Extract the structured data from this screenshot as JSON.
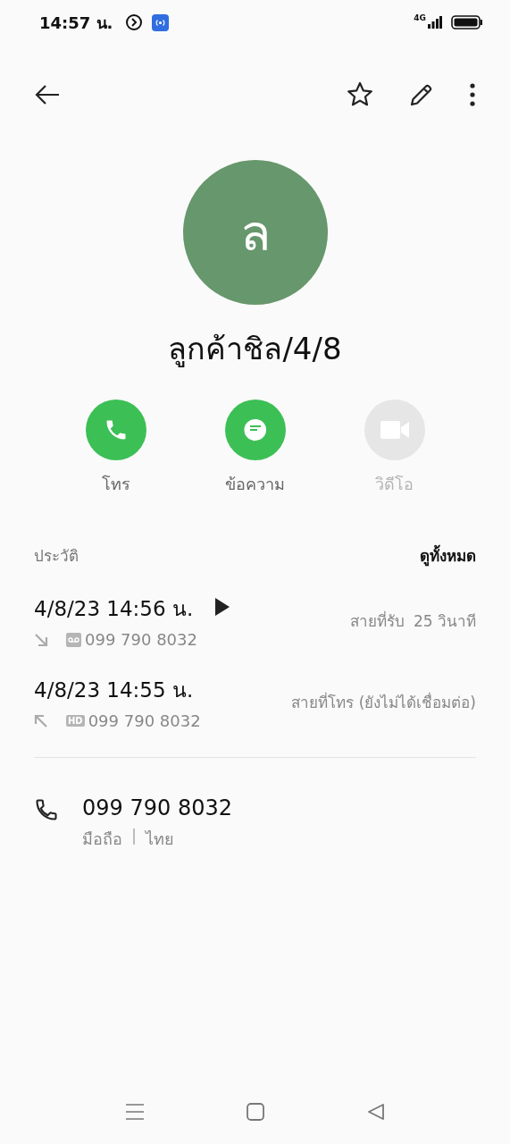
{
  "status_bar": {
    "time": "14:57 น.",
    "network": "4G"
  },
  "contact": {
    "initial": "ล",
    "name": "ลูกค้าชิล/4/8"
  },
  "actions": [
    {
      "kind": "call",
      "label": "โทร",
      "disabled": false
    },
    {
      "kind": "message",
      "label": "ข้อความ",
      "disabled": false
    },
    {
      "kind": "video",
      "label": "วิดีโอ",
      "disabled": true
    }
  ],
  "history": {
    "title": "ประวัติ",
    "link": "ดูทั้งหมด",
    "items": [
      {
        "time": "4/8/23 14:56 น.",
        "play": true,
        "kind": "incoming",
        "badge": {
          "kind": "voicemail"
        },
        "number": "099 790 8032",
        "status": "สายที่รับ",
        "duration": "25 วินาที"
      },
      {
        "time": "4/8/23 14:55 น.",
        "play": false,
        "kind": "outgoing",
        "badge": {
          "kind": "hd",
          "label": "HD"
        },
        "number": "099 790 8032",
        "status": "สายที่โทร (ยังไม่ได้เชื่อมต่อ)"
      }
    ]
  },
  "phone": {
    "number": "099 790 8032",
    "type": "มือถือ",
    "separator": "|",
    "region": "ไทย"
  }
}
